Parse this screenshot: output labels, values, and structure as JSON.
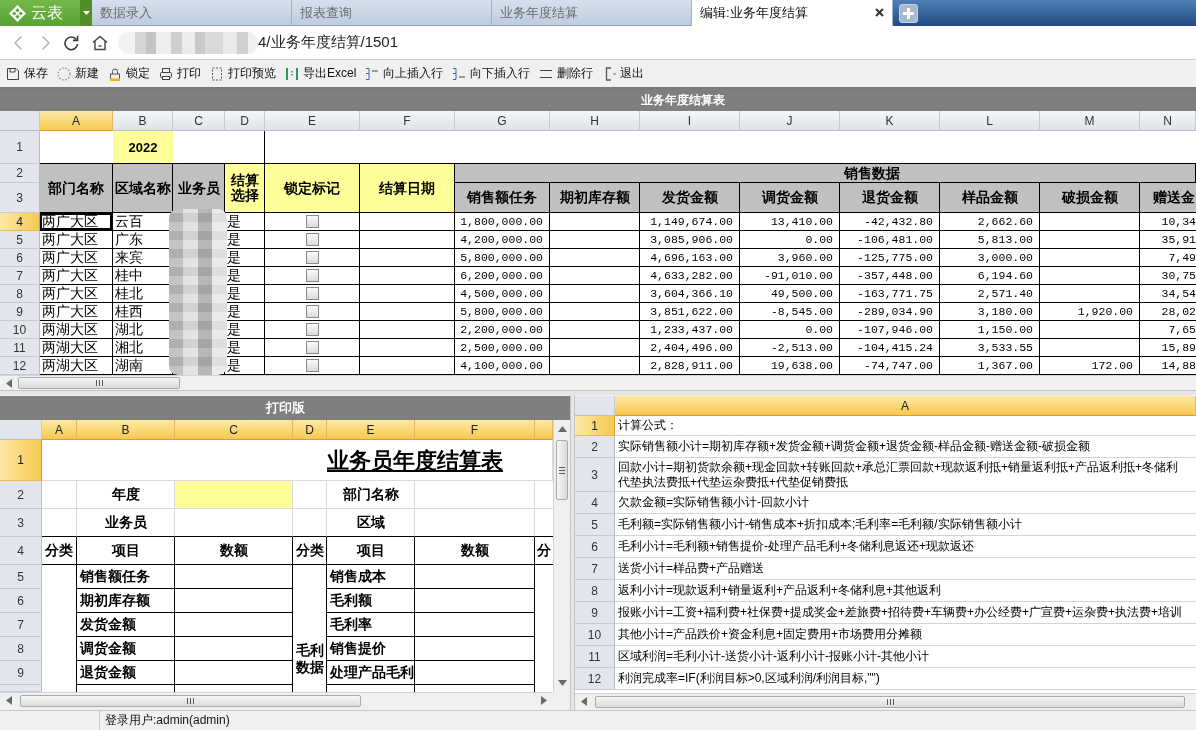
{
  "app": {
    "name": "云表"
  },
  "tabs": [
    {
      "label": "数据录入",
      "selected": false,
      "closable": false
    },
    {
      "label": "报表查询",
      "selected": false,
      "closable": false
    },
    {
      "label": "业务年度结算",
      "selected": false,
      "closable": false
    },
    {
      "label": "编辑:业务年度结算",
      "selected": true,
      "closable": true
    }
  ],
  "address_bar": {
    "url": "4/业务年度结算/1501"
  },
  "toolbar": [
    "保存",
    "新建",
    "锁定",
    "打印",
    "打印预览",
    "导出Excel",
    "向上插入行",
    "向下插入行",
    "删除行",
    "退出"
  ],
  "main_sheet": {
    "title": "业务年度结算表",
    "columns": [
      {
        "label": "A",
        "selected": true
      },
      {
        "label": "B",
        "selected": false
      },
      {
        "label": "C",
        "selected": false
      },
      {
        "label": "D",
        "selected": false
      },
      {
        "label": "E",
        "selected": false
      },
      {
        "label": "F",
        "selected": false
      },
      {
        "label": "G",
        "selected": false
      },
      {
        "label": "H",
        "selected": false
      },
      {
        "label": "I",
        "selected": false
      },
      {
        "label": "J",
        "selected": false
      },
      {
        "label": "K",
        "selected": false
      },
      {
        "label": "L",
        "selected": false
      },
      {
        "label": "M",
        "selected": false
      },
      {
        "label": "N",
        "selected": false
      }
    ],
    "row_numbers": [
      {
        "label": "1",
        "selected": false
      },
      {
        "label": "2",
        "selected": false
      },
      {
        "label": "3",
        "selected": false
      },
      {
        "label": "4",
        "selected": true
      },
      {
        "label": "5",
        "selected": false
      },
      {
        "label": "6",
        "selected": false
      },
      {
        "label": "7",
        "selected": false
      },
      {
        "label": "8",
        "selected": false
      },
      {
        "label": "9",
        "selected": false
      },
      {
        "label": "10",
        "selected": false
      },
      {
        "label": "11",
        "selected": false
      },
      {
        "label": "12",
        "selected": false
      }
    ],
    "year": {
      "value": "2022",
      "highlighted": true
    },
    "headers": [
      {
        "label": "部门名称",
        "highlighted": false
      },
      {
        "label": "区域名称",
        "highlighted": false
      },
      {
        "label": "业务员",
        "highlighted": false
      },
      {
        "label": "结算选择",
        "highlighted": true
      },
      {
        "label": "锁定标记",
        "highlighted": true
      },
      {
        "label": "结算日期",
        "highlighted": true
      }
    ],
    "group_header": "销售数据",
    "sales_headers": [
      "销售额任务",
      "期初库存额",
      "发货金额",
      "调货金额",
      "退货金额",
      "样品金额",
      "破损金额",
      "赠送金"
    ],
    "rows": [
      {
        "department": "两广大区",
        "region": "云百",
        "settle": "是",
        "locked": false,
        "sales_task": "1,800,000.00",
        "shipped": "1,149,674.00",
        "transfer": "13,410.00",
        "returns": "-42,432.80",
        "samples": "2,662.60",
        "gifts": "10,34"
      },
      {
        "department": "两广大区",
        "region": "广东",
        "settle": "是",
        "locked": false,
        "sales_task": "4,200,000.00",
        "shipped": "3,085,906.00",
        "transfer": "0.00",
        "returns": "-106,481.00",
        "samples": "5,813.00",
        "gifts": "35,91"
      },
      {
        "department": "两广大区",
        "region": "来宾",
        "settle": "是",
        "locked": false,
        "sales_task": "5,800,000.00",
        "shipped": "4,696,163.00",
        "transfer": "3,960.00",
        "returns": "-125,775.00",
        "samples": "3,000.00",
        "gifts": "7,49"
      },
      {
        "department": "两广大区",
        "region": "桂中",
        "settle": "是",
        "locked": false,
        "sales_task": "6,200,000.00",
        "shipped": "4,633,282.00",
        "transfer": "-91,010.00",
        "returns": "-357,448.00",
        "samples": "6,194.60",
        "gifts": "30,75"
      },
      {
        "department": "两广大区",
        "region": "桂北",
        "settle": "是",
        "locked": false,
        "sales_task": "4,500,000.00",
        "shipped": "3,604,366.10",
        "transfer": "49,500.00",
        "returns": "-163,771.75",
        "samples": "2,571.40",
        "gifts": "34,54"
      },
      {
        "department": "两广大区",
        "region": "桂西",
        "settle": "是",
        "locked": false,
        "sales_task": "5,800,000.00",
        "shipped": "3,851,622.00",
        "transfer": "-8,545.00",
        "returns": "-289,034.90",
        "samples": "3,180.00",
        "damaged": "1,920.00",
        "gifts": "28,02"
      },
      {
        "department": "两湖大区",
        "region": "湖北",
        "settle": "是",
        "locked": false,
        "sales_task": "2,200,000.00",
        "shipped": "1,233,437.00",
        "transfer": "0.00",
        "returns": "-107,946.00",
        "samples": "1,150.00",
        "gifts": "7,65"
      },
      {
        "department": "两湖大区",
        "region": "湘北",
        "settle": "是",
        "locked": false,
        "sales_task": "2,500,000.00",
        "shipped": "2,404,496.00",
        "transfer": "-2,513.00",
        "returns": "-104,415.24",
        "samples": "3,533.55",
        "gifts": "15,89"
      },
      {
        "department": "两湖大区",
        "region": "湖南",
        "settle": "是",
        "locked": false,
        "sales_task": "4,100,000.00",
        "shipped": "2,828,911.00",
        "transfer": "19,638.00",
        "returns": "-74,747.00",
        "samples": "1,367.00",
        "damaged": "172.00",
        "gifts": "14,88"
      }
    ]
  },
  "print_sheet": {
    "title": "打印版",
    "columns": [
      {
        "label": "A",
        "selected": true
      },
      {
        "label": "B",
        "selected": true
      },
      {
        "label": "C",
        "selected": true
      },
      {
        "label": "D",
        "selected": true
      },
      {
        "label": "E",
        "selected": true
      },
      {
        "label": "F",
        "selected": true
      },
      {
        "selected": true
      }
    ],
    "row_numbers": [
      {
        "label": "1",
        "selected": true
      },
      {
        "label": "2",
        "selected": false
      },
      {
        "label": "3",
        "selected": false
      },
      {
        "label": "4",
        "selected": false
      },
      {
        "label": "5",
        "selected": false
      },
      {
        "label": "6",
        "selected": false
      },
      {
        "label": "7",
        "selected": false
      },
      {
        "label": "8",
        "selected": false
      },
      {
        "label": "9",
        "selected": false
      }
    ],
    "heading": "业务员年度结算表",
    "fields": [
      {
        "label": "年度",
        "highlighted": true
      },
      {
        "label": "部门名称",
        "highlighted": false
      },
      {
        "label": "业务员",
        "highlighted": false
      },
      {
        "label": "区域",
        "highlighted": false
      }
    ],
    "table_headers": [
      "分类",
      "项目",
      "数额",
      "分类",
      "项目",
      "数额",
      "分"
    ],
    "left_items": [
      "销售额任务",
      "期初库存额",
      "发货金额",
      "调货金额",
      "退货金额"
    ],
    "middle_category": "毛利数据",
    "right_items": [
      "销售成本",
      "毛利额",
      "毛利率",
      "销售提价",
      "处理产品毛利"
    ]
  },
  "formula_sheet": {
    "columns": [
      {
        "label": "A",
        "selected": true
      }
    ],
    "rows": [
      {
        "label": "1",
        "selected": true,
        "lines": [
          "计算公式："
        ]
      },
      {
        "label": "2",
        "selected": false,
        "lines": [
          "实际销售额小计=期初库存额+发货金额+调货金额+退货金额-样品金额-赠送金额-破损金额"
        ]
      },
      {
        "label": "3",
        "selected": false,
        "lines": [
          "回款小计=期初货款余额+现金回款+转账回款+承总汇票回款+现款返利抵+销量返利抵+产品返利抵+冬储利",
          "代垫执法费抵+代垫运杂费抵+代垫促销费抵"
        ]
      },
      {
        "label": "4",
        "selected": false,
        "lines": [
          "欠款金额=实际销售额小计-回款小计"
        ]
      },
      {
        "label": "5",
        "selected": false,
        "lines": [
          "毛利额=实际销售额小计-销售成本+折扣成本;毛利率=毛利额/实际销售额小计"
        ]
      },
      {
        "label": "6",
        "selected": false,
        "lines": [
          "毛利小计=毛利额+销售提价-处理产品毛利+冬储利息返还+现款返还"
        ]
      },
      {
        "label": "7",
        "selected": false,
        "lines": [
          "送货小计=样品费+产品赠送"
        ]
      },
      {
        "label": "8",
        "selected": false,
        "lines": [
          "返利小计=现款返利+销量返利+产品返利+冬储利息+其他返利"
        ]
      },
      {
        "label": "9",
        "selected": false,
        "lines": [
          "报账小计=工资+福利费+社保费+提成奖金+差旅费+招待费+车辆费+办公经费+广宣费+运杂费+执法费+培训"
        ]
      },
      {
        "label": "10",
        "selected": false,
        "lines": [
          "其他小计=产品跌价+资金利息+固定费用+市场费用分摊额"
        ]
      },
      {
        "label": "11",
        "selected": false,
        "lines": [
          "区域利润=毛利小计-送货小计-返利小计-报账小计-其他小计"
        ]
      },
      {
        "label": "12",
        "selected": false,
        "lines": [
          "利润完成率=IF(利润目标>0,区域利润/利润目标,\"\")"
        ]
      }
    ]
  },
  "status_bar": {
    "user": "登录用户:admin(admin)"
  }
}
